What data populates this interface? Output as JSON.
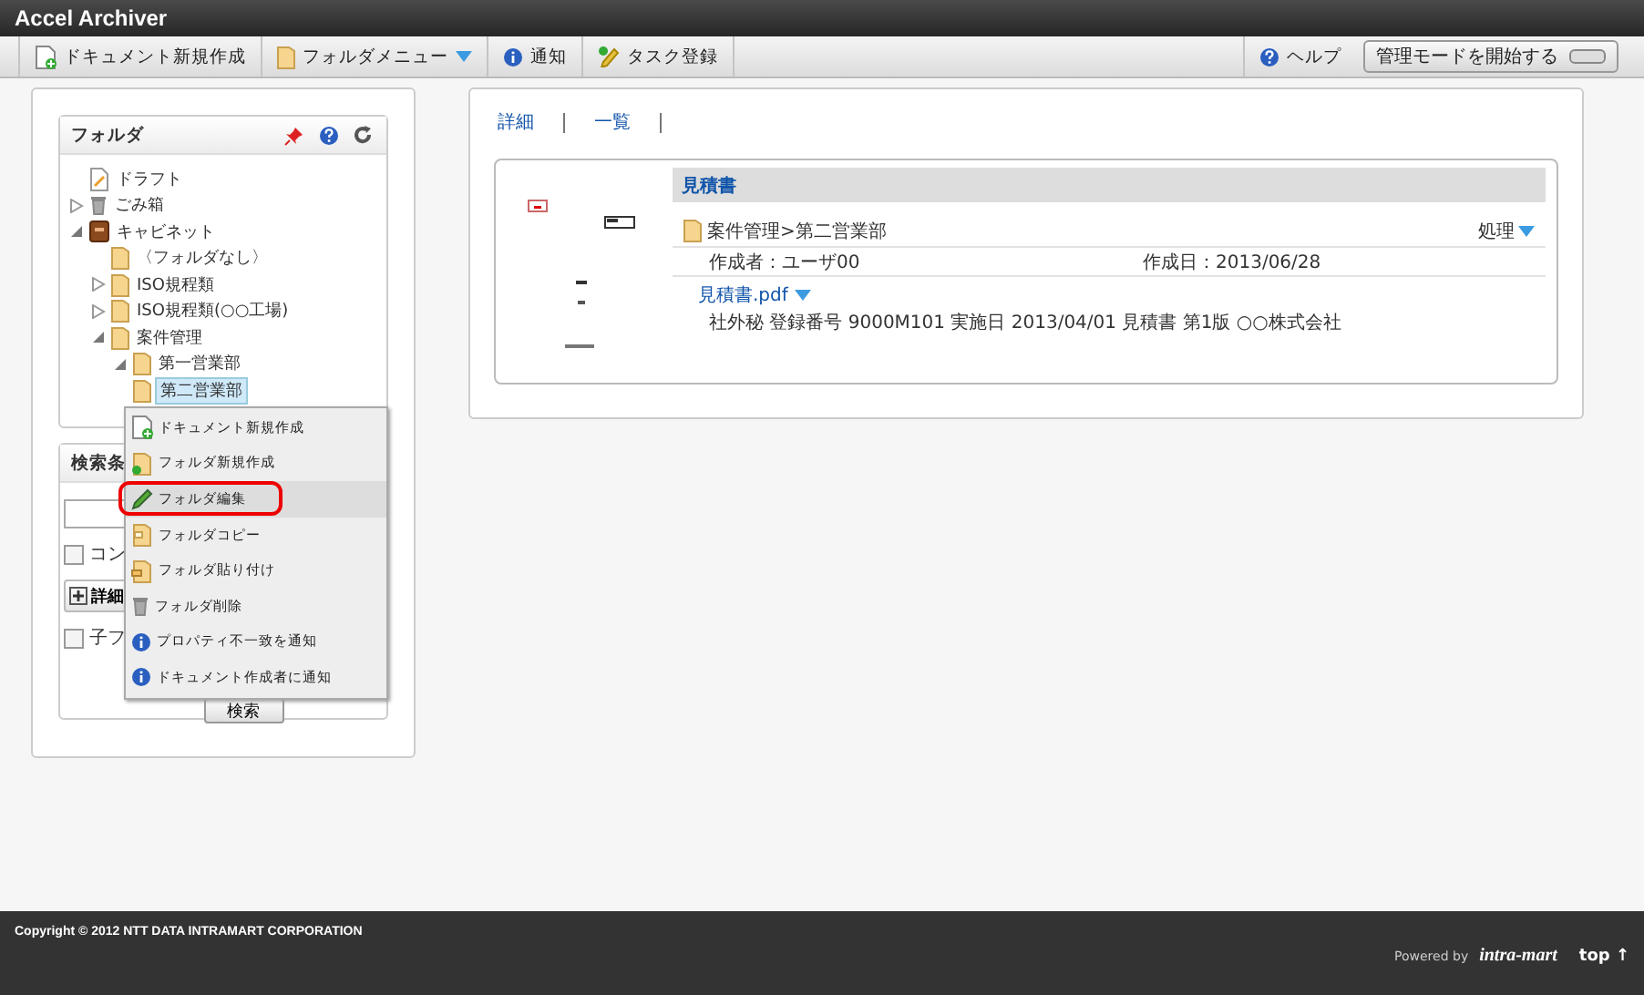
{
  "window": {
    "title": "Accel Archiver"
  },
  "toolbar": {
    "left": [
      {
        "kind": "doc",
        "label": "ドキュメント新規作成",
        "caret": false
      },
      {
        "kind": "folder",
        "label": "フォルダメニュー",
        "caret": true
      },
      {
        "kind": "info",
        "label": "通知",
        "caret": false
      },
      {
        "kind": "task",
        "label": "タスク登録",
        "caret": false
      }
    ],
    "help": {
      "label": "ヘルプ"
    },
    "admin_button": {
      "label": "管理モードを開始する",
      "on": false
    }
  },
  "folder_panel": {
    "title": "フォルダ",
    "tree": [
      {
        "label": "ドラフト",
        "kind": "draft",
        "selected": false
      },
      {
        "label": "ごみ箱",
        "kind": "trash",
        "expanded": false,
        "selected": false
      },
      {
        "label": "キャビネット",
        "kind": "cabinet",
        "expanded": true,
        "selected": false,
        "children": [
          {
            "label": "〈フォルダなし〉",
            "kind": "folder",
            "selected": false
          },
          {
            "label": "ISO規程類",
            "kind": "folder",
            "expanded": false,
            "selected": false
          },
          {
            "label": "ISO規程類(○○工場)",
            "kind": "folder",
            "expanded": false,
            "selected": false
          },
          {
            "label": "案件管理",
            "kind": "folder",
            "expanded": true,
            "selected": false,
            "children": [
              {
                "label": "第一営業部",
                "kind": "folder",
                "expanded": true,
                "selected": false
              },
              {
                "label": "第二営業部",
                "kind": "folder",
                "selected": true
              }
            ]
          }
        ]
      }
    ]
  },
  "search_panel": {
    "title": "検索条",
    "checkboxes": [
      {
        "label": "コン",
        "checked": false
      },
      {
        "label": "子フ",
        "checked": false
      }
    ],
    "detail_button": "詳細",
    "search_button": "検索"
  },
  "context_menu": [
    {
      "kind": "doc",
      "label": "ドキュメント新規作成",
      "selected": false
    },
    {
      "kind": "newfolder",
      "label": "フォルダ新規作成",
      "selected": false
    },
    {
      "kind": "edit",
      "label": "フォルダ編集",
      "selected": true
    },
    {
      "kind": "copy",
      "label": "フォルダコピー",
      "selected": false
    },
    {
      "kind": "paste",
      "label": "フォルダ貼り付け",
      "selected": false
    },
    {
      "kind": "trash",
      "label": "フォルダ削除",
      "selected": false
    },
    {
      "kind": "info",
      "label": "プロパティ不一致を通知",
      "selected": false
    },
    {
      "kind": "info",
      "label": "ドキュメント作成者に通知",
      "selected": false
    }
  ],
  "view_tabs": [
    {
      "label": "詳細"
    },
    {
      "label": "一覧"
    }
  ],
  "document": {
    "title": "見積書",
    "path": "案件管理>第二営業部",
    "action": "処理",
    "author": "作成者：ユーザ00",
    "created": "作成日：2013/06/28",
    "file": "見積書.pdf",
    "description": "社外秘  登録番号 9000M101  実施日 2013/04/01 見積書 第1版 ○○株式会社"
  },
  "footer": {
    "copyright": "Copyright © 2012 NTT DATA INTRAMART CORPORATION",
    "powered": "Powered by",
    "logo": "intra-mart",
    "top": "top ↑"
  }
}
